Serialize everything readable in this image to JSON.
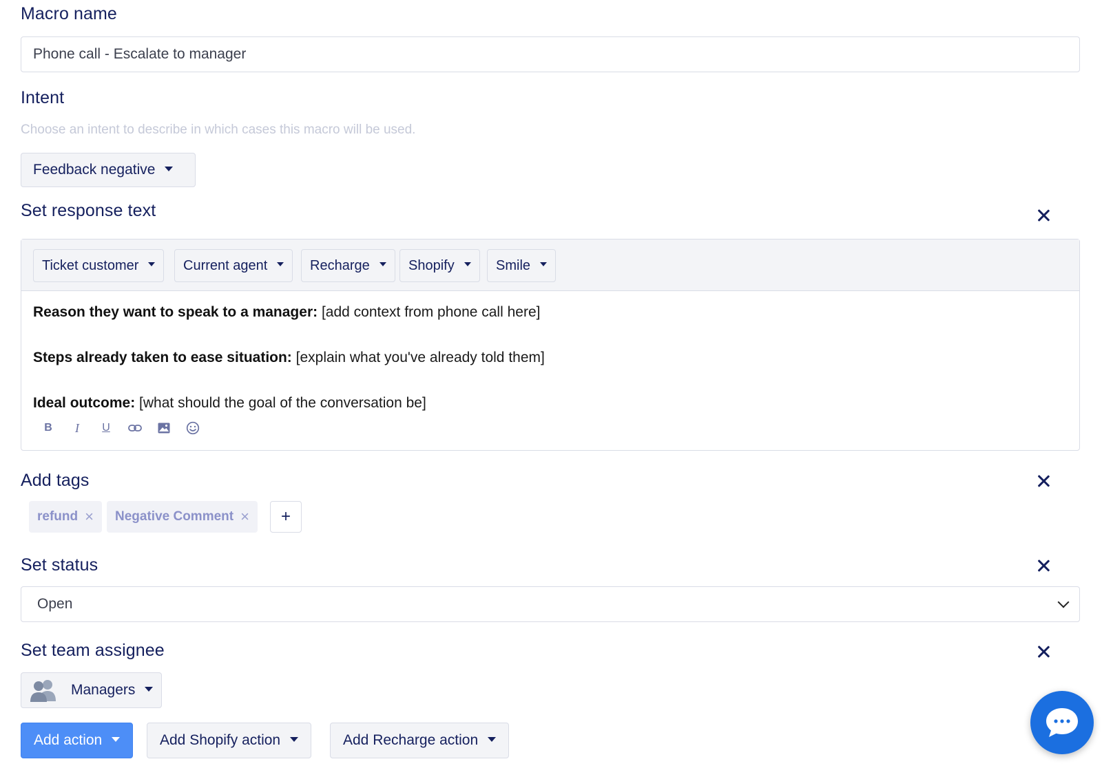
{
  "macro_name": {
    "label": "Macro name",
    "value": "Phone call - Escalate to manager"
  },
  "intent": {
    "label": "Intent",
    "helper": "Choose an intent to describe in which cases this macro will be used.",
    "selected": "Feedback negative"
  },
  "response_text": {
    "label": "Set response text",
    "variable_buttons": [
      "Ticket customer",
      "Current agent",
      "Recharge",
      "Shopify",
      "Smile"
    ],
    "lines": [
      {
        "bold": "Reason they want to speak to a manager:",
        "text": " [add context from phone call here]"
      },
      {
        "bold": "Steps already taken to ease situation:",
        "text": " [explain what you've already told them]"
      },
      {
        "bold": "Ideal outcome:",
        "text": " [what should the goal of the conversation be]"
      }
    ],
    "format_buttons": {
      "bold": "B",
      "italic": "I",
      "underline": "U"
    }
  },
  "tags": {
    "label": "Add tags",
    "items": [
      "refund",
      "Negative Comment"
    ],
    "remove_glyph": "×",
    "add_glyph": "+"
  },
  "status": {
    "label": "Set status",
    "selected": "Open"
  },
  "team_assignee": {
    "label": "Set team assignee",
    "selected": "Managers"
  },
  "actions": {
    "add_action": "Add action",
    "add_shopify_action": "Add Shopify action",
    "add_recharge_action": "Add Recharge action"
  },
  "colors": {
    "heading": "#15205e",
    "primary": "#4d8ef7",
    "tag_text": "#8b91c9",
    "chat_fab": "#1b6fe0"
  },
  "icons": {
    "close": "close-icon",
    "caret": "caret-down-icon",
    "team": "team-users-icon",
    "chat": "chat-bubble-icon"
  }
}
